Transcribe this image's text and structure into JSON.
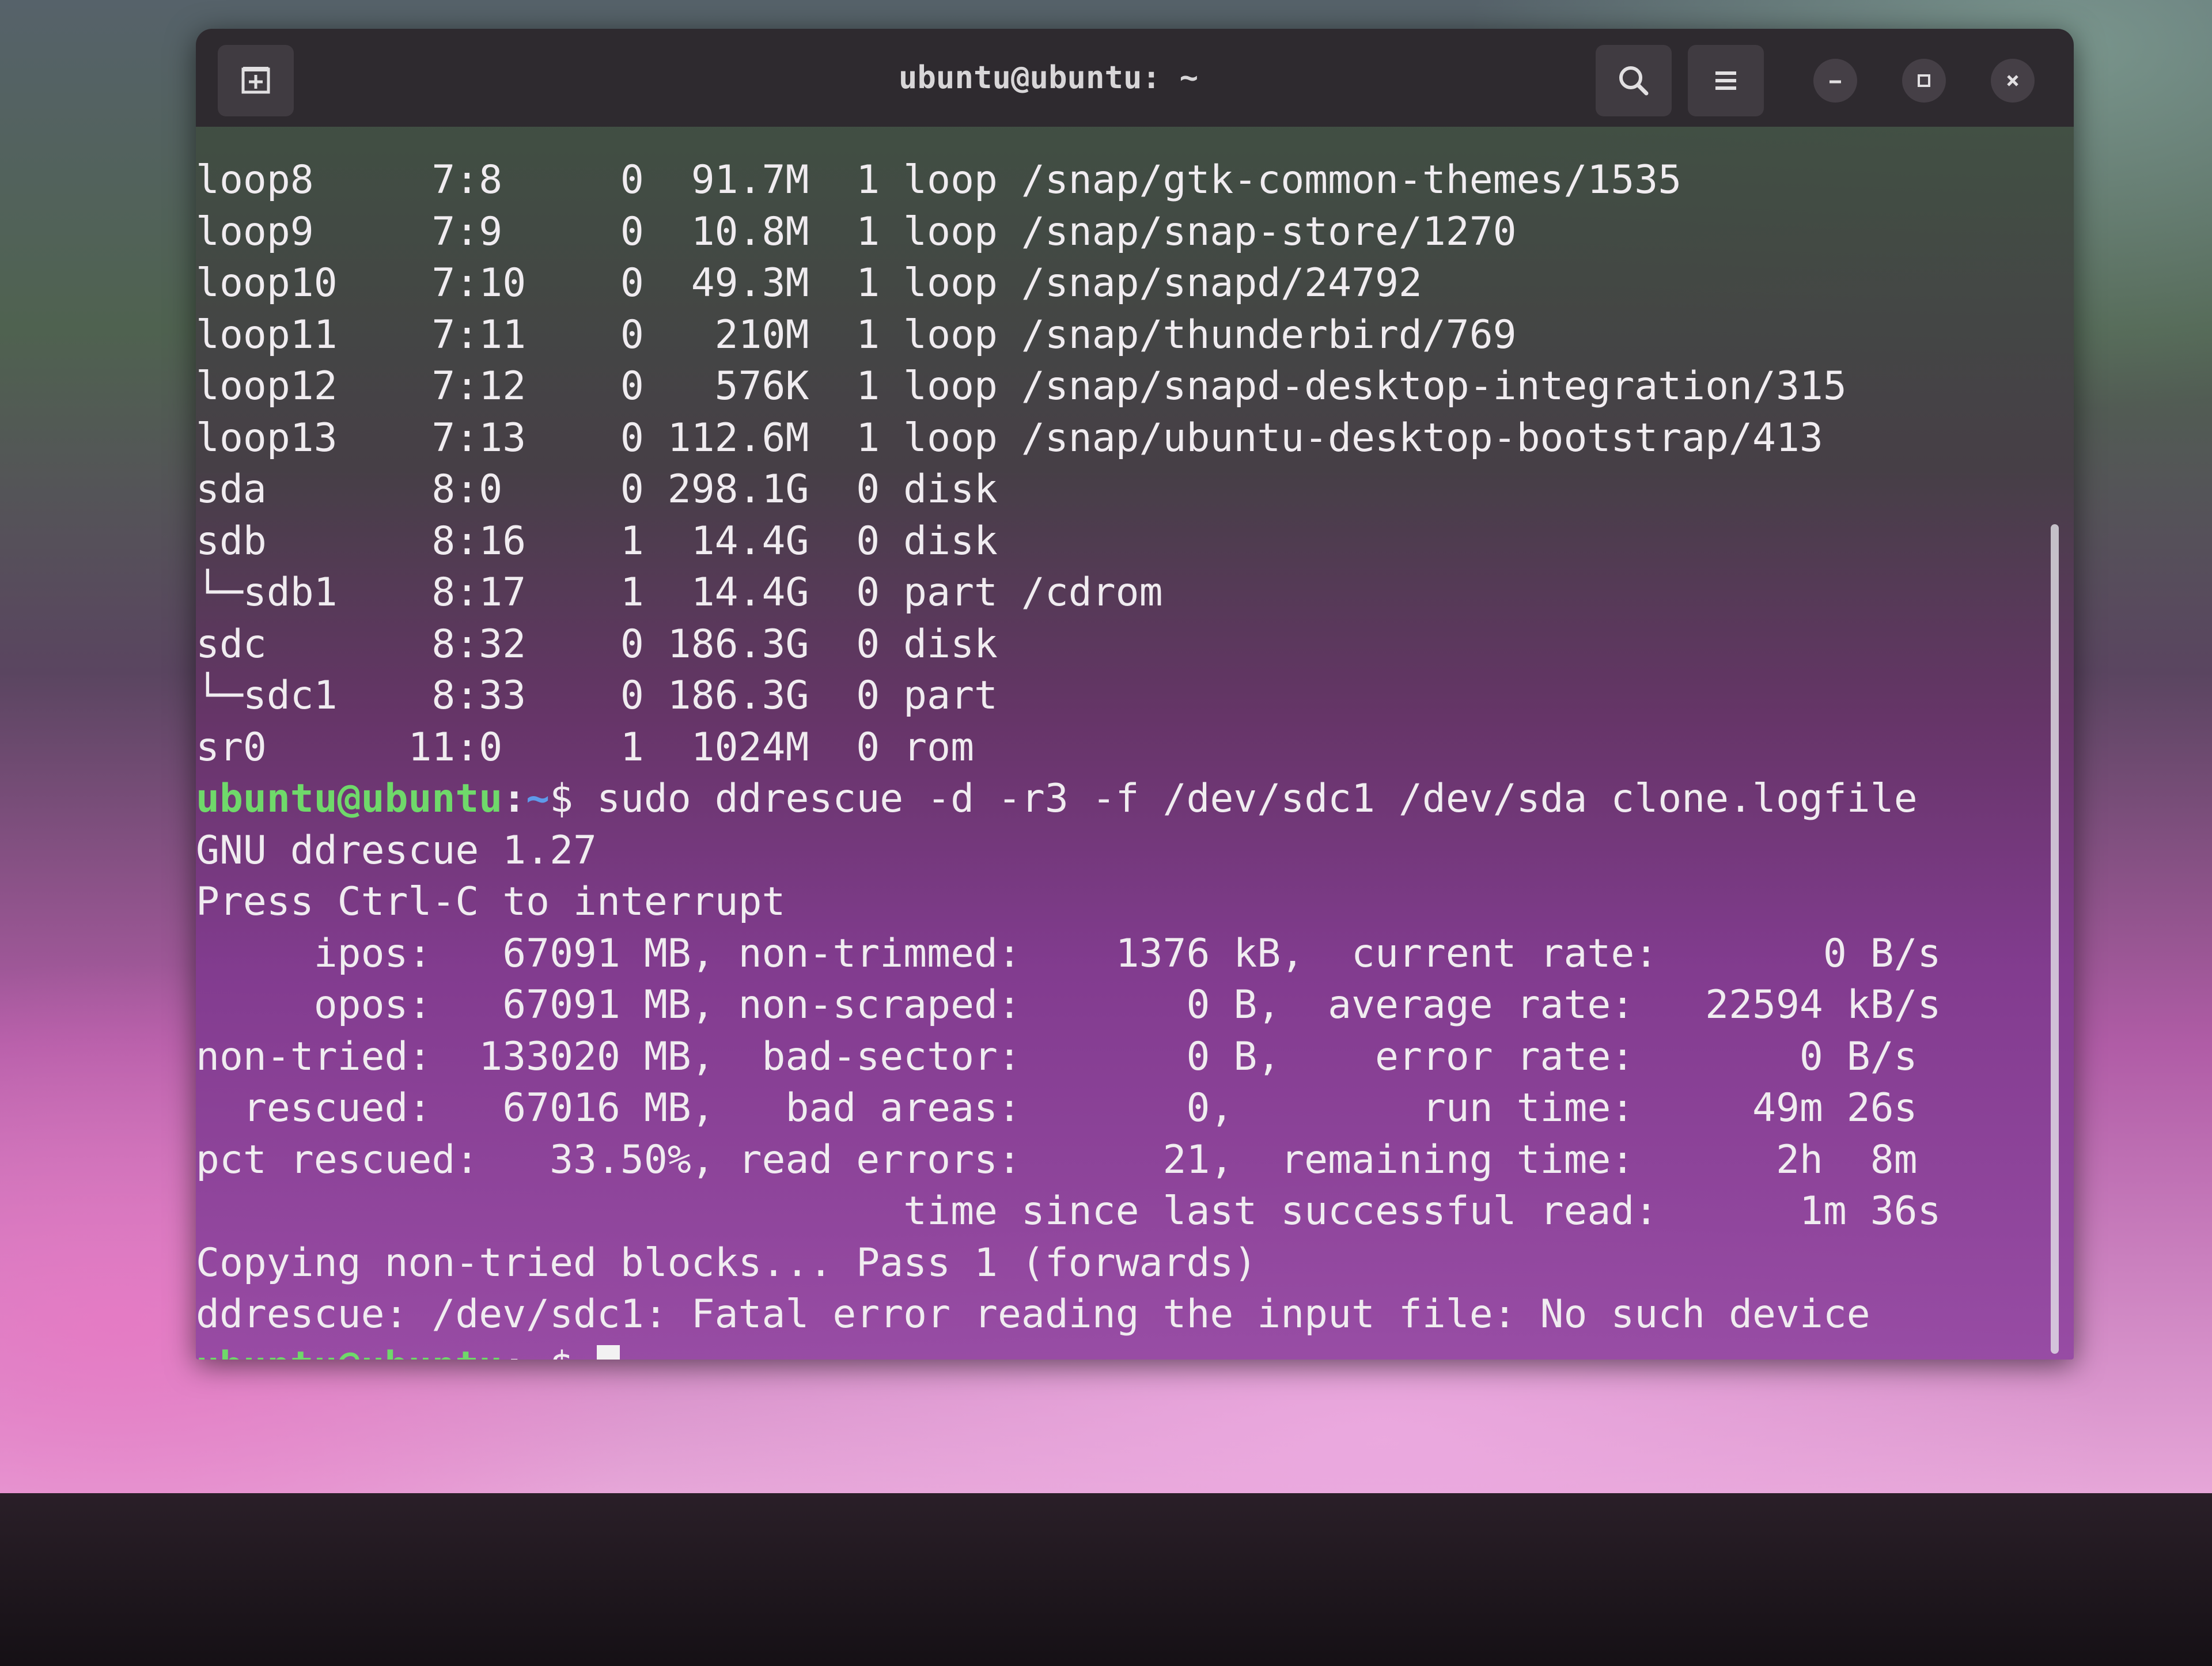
{
  "window": {
    "title": "ubuntu@ubuntu: ~"
  },
  "icons": {
    "new_tab": "new-tab-icon",
    "search": "search-icon",
    "menu": "hamburger-menu-icon",
    "minimize": "minimize-icon",
    "maximize": "maximize-icon",
    "close": "close-icon"
  },
  "colors": {
    "prompt_user": "#6fd96a",
    "prompt_path": "#5e9bea",
    "titlebar": "#2e2a2f"
  },
  "terminal": {
    "output_lines": [
      "loop8     7:8     0  91.7M  1 loop /snap/gtk-common-themes/1535",
      "loop9     7:9     0  10.8M  1 loop /snap/snap-store/1270",
      "loop10    7:10    0  49.3M  1 loop /snap/snapd/24792",
      "loop11    7:11    0   210M  1 loop /snap/thunderbird/769",
      "loop12    7:12    0   576K  1 loop /snap/snapd-desktop-integration/315",
      "loop13    7:13    0 112.6M  1 loop /snap/ubuntu-desktop-bootstrap/413",
      "sda       8:0     0 298.1G  0 disk",
      "sdb       8:16    1  14.4G  0 disk",
      "└─sdb1    8:17    1  14.4G  0 part /cdrom",
      "sdc       8:32    0 186.3G  0 disk",
      "└─sdc1    8:33    0 186.3G  0 part",
      "sr0      11:0     1  1024M  0 rom"
    ],
    "command_prompt": {
      "user_host": "ubuntu@ubuntu",
      "colon": ":",
      "path": "~",
      "dollar": "$",
      "command": " sudo ddrescue -d -r3 -f /dev/sdc1 /dev/sda clone.logfile"
    },
    "ddrescue_lines": [
      "GNU ddrescue 1.27",
      "Press Ctrl-C to interrupt",
      "     ipos:   67091 MB, non-trimmed:    1376 kB,  current rate:       0 B/s",
      "     opos:   67091 MB, non-scraped:       0 B,  average rate:   22594 kB/s",
      "non-tried:  133020 MB,  bad-sector:       0 B,    error rate:       0 B/s",
      "  rescued:   67016 MB,   bad areas:       0,        run time:     49m 26s",
      "pct rescued:   33.50%, read errors:      21,  remaining time:      2h  8m",
      "                              time since last successful read:      1m 36s",
      "Copying non-tried blocks... Pass 1 (forwards)",
      "ddrescue: /dev/sdc1: Fatal error reading the input file: No such device"
    ],
    "final_prompt": {
      "user_host": "ubuntu@ubuntu",
      "colon": ":",
      "path": "~",
      "dollar": "$ "
    }
  }
}
